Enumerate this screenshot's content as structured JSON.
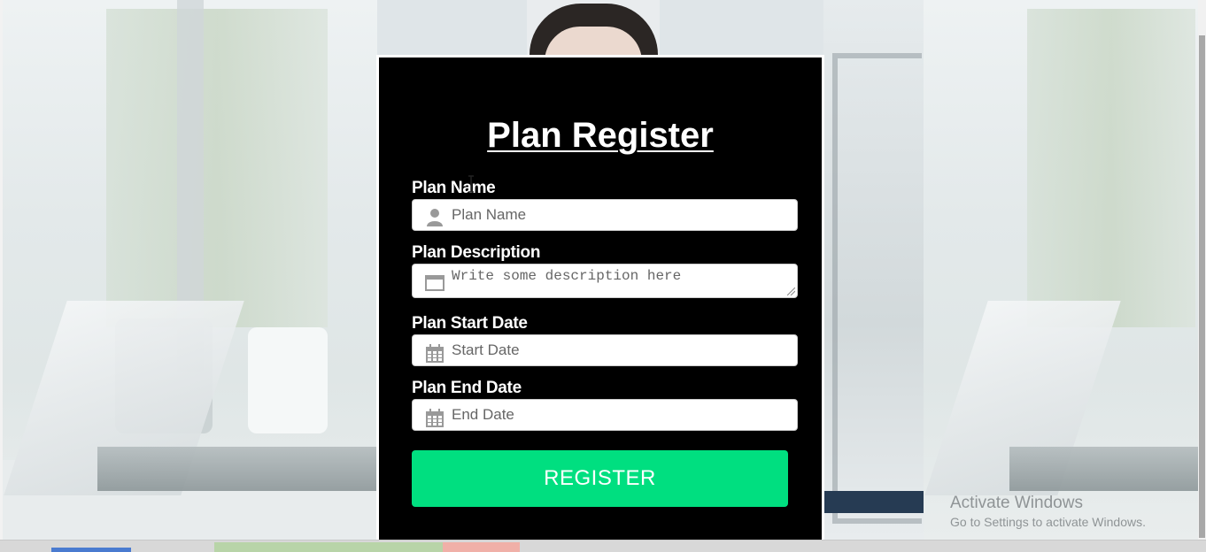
{
  "form": {
    "title": "Plan Register",
    "fields": [
      {
        "label": "Plan Name",
        "placeholder": "Plan Name",
        "icon": "user-icon"
      },
      {
        "label": "Plan Description",
        "placeholder": "Write some description here",
        "icon": "window-icon"
      },
      {
        "label": "Plan Start Date",
        "placeholder": "Start Date",
        "icon": "calendar-icon"
      },
      {
        "label": "Plan End Date",
        "placeholder": "End Date",
        "icon": "calendar-icon"
      }
    ],
    "submit_label": "REGISTER"
  },
  "os_watermark": {
    "title": "Activate Windows",
    "subtitle": "Go to Settings to activate Windows."
  },
  "colors": {
    "card_bg": "#000000",
    "button": "#00df80",
    "text": "#ffffff"
  }
}
